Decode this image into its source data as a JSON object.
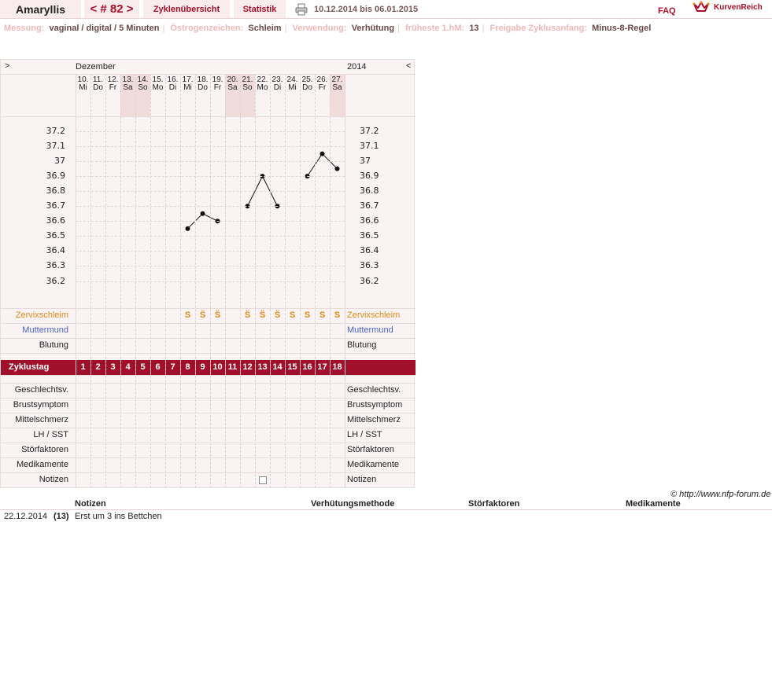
{
  "header": {
    "name": "Amaryllis",
    "cycle_nav": "< # 82 >",
    "overview_tab": "Zyklenübersicht",
    "stats_tab": "Statistik",
    "date_range": "10.12.2014 bis 06.01.2015",
    "faq": "FAQ",
    "logo": "KurvenReich"
  },
  "info": {
    "items": [
      {
        "label": "Messung:",
        "value": "vaginal / digital / 5 Minuten"
      },
      {
        "label": "Östrogenzeichen:",
        "value": "Schleim"
      },
      {
        "label": "Verwendung:",
        "value": "Verhütung"
      },
      {
        "label": "früheste 1.hM:",
        "value": "13"
      },
      {
        "label": "Freigabe Zyklusanfang:",
        "value": "Minus-8-Regel"
      }
    ]
  },
  "chart": {
    "nav_left": ">",
    "nav_right": "<",
    "month": "Dezember",
    "year": "2014",
    "days": [
      {
        "date": "10.",
        "weekday": "Mi"
      },
      {
        "date": "11.",
        "weekday": "Do"
      },
      {
        "date": "12.",
        "weekday": "Fr"
      },
      {
        "date": "13.",
        "weekday": "Sa"
      },
      {
        "date": "14.",
        "weekday": "So"
      },
      {
        "date": "15.",
        "weekday": "Mo"
      },
      {
        "date": "16.",
        "weekday": "Di"
      },
      {
        "date": "17.",
        "weekday": "Mi"
      },
      {
        "date": "18.",
        "weekday": "Do"
      },
      {
        "date": "19.",
        "weekday": "Fr"
      },
      {
        "date": "20.",
        "weekday": "Sa"
      },
      {
        "date": "21.",
        "weekday": "So"
      },
      {
        "date": "22.",
        "weekday": "Mo"
      },
      {
        "date": "23.",
        "weekday": "Di"
      },
      {
        "date": "24.",
        "weekday": "Mi"
      },
      {
        "date": "25.",
        "weekday": "Do"
      },
      {
        "date": "26.",
        "weekday": "Fr"
      },
      {
        "date": "27.",
        "weekday": "Sa"
      }
    ],
    "temp_ticks": [
      "37.2",
      "37.1",
      "37",
      "36.9",
      "36.8",
      "36.7",
      "36.6",
      "36.5",
      "36.4",
      "36.3",
      "36.2"
    ],
    "row_labels": {
      "mucus": "Zervixschleim",
      "cervix": "Muttermund",
      "bleeding": "Blutung",
      "cycle_day": "Zyklustag",
      "intercourse": "Geschlechtsv.",
      "breast": "Brustsymptom",
      "midpain": "Mittelschmerz",
      "lh": "LH / SST",
      "disturb": "Störfaktoren",
      "meds": "Medikamente",
      "notes": "Notizen"
    },
    "mucus_marks": [
      "",
      "",
      "",
      "",
      "",
      "",
      "",
      "S",
      "S̈",
      "S̈",
      "",
      "S̈",
      "S̈",
      "S̈",
      "S",
      "S",
      "S",
      "S"
    ],
    "note_day": 13,
    "colors": {
      "accent": "#a0102a",
      "mucus": "#e08a1a",
      "cervix": "#4a63c8"
    }
  },
  "chart_data": {
    "type": "line",
    "x": [
      1,
      2,
      3,
      4,
      5,
      6,
      7,
      8,
      9,
      10,
      11,
      12,
      13,
      14,
      15,
      16,
      17,
      18
    ],
    "series": [
      {
        "values": [
          null,
          null,
          null,
          null,
          null,
          null,
          null,
          36.55,
          36.65,
          36.6,
          null,
          36.7,
          36.9,
          36.7,
          null,
          36.9,
          37.05,
          36.95
        ]
      }
    ],
    "ylim": [
      36.1,
      37.3
    ],
    "cycle_days": [
      "1",
      "2",
      "3",
      "4",
      "5",
      "6",
      "7",
      "8",
      "9",
      "10",
      "11",
      "12",
      "13",
      "14",
      "15",
      "16",
      "17",
      "18"
    ]
  },
  "footer": {
    "copyright": "© http://www.nfp-forum.de",
    "col_notes": "Notizen",
    "col_method": "Verhütungsmethode",
    "col_disturb": "Störfaktoren",
    "col_meds": "Medikamente",
    "rows": [
      {
        "date": "22.12.2014",
        "day": "(13)",
        "note": "Erst um 3 ins Bettchen"
      }
    ]
  }
}
